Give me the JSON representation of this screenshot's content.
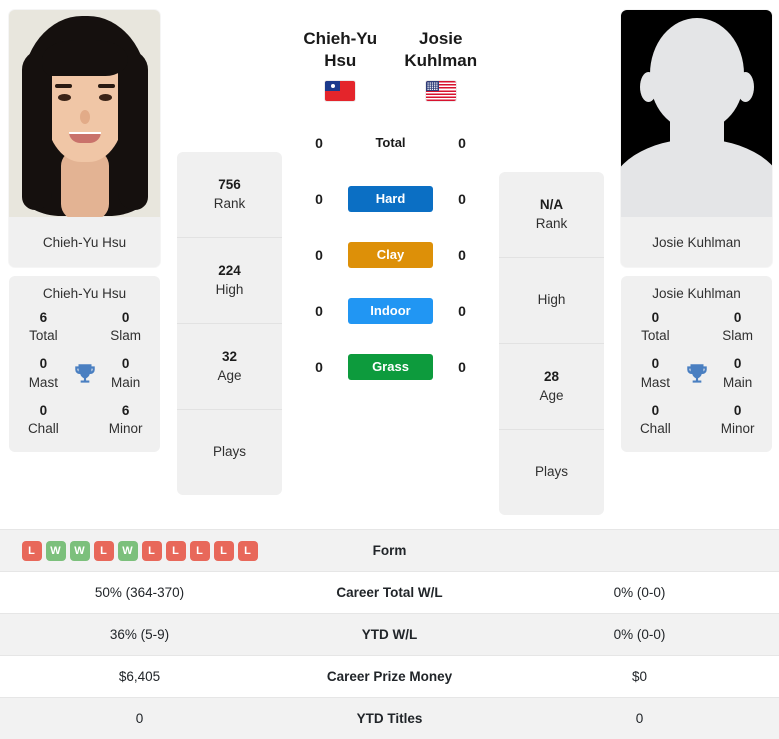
{
  "players": {
    "left": {
      "name": "Chieh-Yu Hsu",
      "photo_caption": "Chieh-Yu Hsu",
      "flag": "taiwan-flag",
      "titles": {
        "panel_name": "Chieh-Yu Hsu",
        "rows": [
          {
            "left_value": "6",
            "left_label": "Total",
            "right_value": "0",
            "right_label": "Slam"
          },
          {
            "left_value": "0",
            "left_label": "Mast",
            "right_value": "0",
            "right_label": "Main"
          },
          {
            "left_value": "0",
            "left_label": "Chall",
            "right_value": "6",
            "right_label": "Minor"
          }
        ],
        "icon": "trophy-icon"
      },
      "numbers": [
        {
          "value": "756",
          "label": "Rank"
        },
        {
          "value": "224",
          "label": "High"
        },
        {
          "value": "32",
          "label": "Age"
        },
        {
          "value": "",
          "label": "Plays"
        }
      ],
      "surface_counts": {
        "total": "0",
        "hard": "0",
        "clay": "0",
        "indoor": "0",
        "grass": "0"
      }
    },
    "right": {
      "name_line1": "Josie",
      "name_line2": "Kuhlman",
      "photo_caption": "Josie Kuhlman",
      "flag": "usa-flag",
      "titles": {
        "panel_name": "Josie Kuhlman",
        "rows": [
          {
            "left_value": "0",
            "left_label": "Total",
            "right_value": "0",
            "right_label": "Slam"
          },
          {
            "left_value": "0",
            "left_label": "Mast",
            "right_value": "0",
            "right_label": "Main"
          },
          {
            "left_value": "0",
            "left_label": "Chall",
            "right_value": "0",
            "right_label": "Minor"
          }
        ],
        "icon": "trophy-icon"
      },
      "numbers": [
        {
          "value": "N/A",
          "label": "Rank"
        },
        {
          "value": "",
          "label": "High"
        },
        {
          "value": "28",
          "label": "Age"
        },
        {
          "value": "",
          "label": "Plays"
        }
      ],
      "surface_counts": {
        "total": "0",
        "hard": "0",
        "clay": "0",
        "indoor": "0",
        "grass": "0"
      }
    }
  },
  "surfaces": [
    {
      "key": "total",
      "label": "Total",
      "color": "transparent",
      "plain": true
    },
    {
      "key": "hard",
      "label": "Hard",
      "color": "#0b6fc4",
      "plain": false
    },
    {
      "key": "clay",
      "label": "Clay",
      "color": "#dd9008",
      "plain": false
    },
    {
      "key": "indoor",
      "label": "Indoor",
      "color": "#2196f3",
      "plain": false
    },
    {
      "key": "grass",
      "label": "Grass",
      "color": "#0d9b3d",
      "plain": false
    }
  ],
  "form": {
    "label": "Form",
    "left_results": [
      "L",
      "W",
      "W",
      "L",
      "W",
      "L",
      "L",
      "L",
      "L",
      "L"
    ],
    "right_results": [],
    "win_color": "#7cc07c",
    "loss_color": "#e8685a"
  },
  "stats_rows": [
    {
      "left": "50% (364-370)",
      "label": "Career Total W/L",
      "right": "0% (0-0)"
    },
    {
      "left": "36% (5-9)",
      "label": "YTD W/L",
      "right": "0% (0-0)"
    },
    {
      "left": "$6,405",
      "label": "Career Prize Money",
      "right": "$0"
    },
    {
      "left": "0",
      "label": "YTD Titles",
      "right": "0"
    }
  ]
}
